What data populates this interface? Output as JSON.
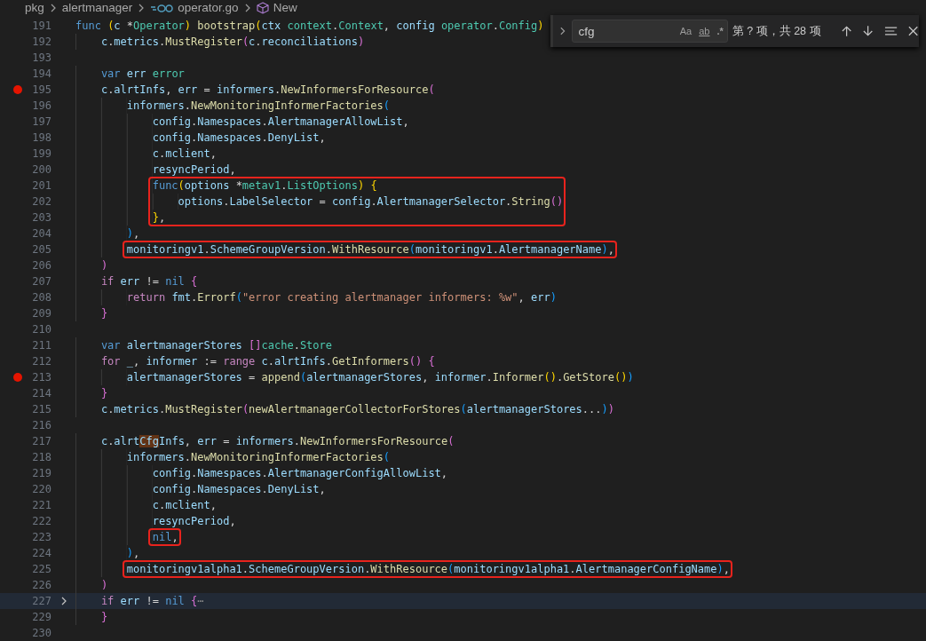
{
  "breadcrumb": [
    {
      "kind": "folder",
      "label": "pkg"
    },
    {
      "kind": "folder",
      "label": "alertmanager"
    },
    {
      "kind": "go-file",
      "label": "operator.go"
    },
    {
      "kind": "symbol",
      "label": "New"
    }
  ],
  "find_widget": {
    "query": "cfg",
    "options": [
      {
        "kind": "case",
        "label": "Aa",
        "on": false
      },
      {
        "kind": "word",
        "label": "ab",
        "on": false
      },
      {
        "kind": "regex",
        "label": ".*",
        "on": false
      }
    ],
    "result": "第 ? 项，共 28 项"
  },
  "lines": [
    {
      "number": "191",
      "breakpoint": false,
      "folded": false,
      "current": false,
      "boxed": false,
      "segments": [
        {
          "kind": "kw",
          "text": "func "
        },
        {
          "kind": "b1",
          "text": "("
        },
        {
          "kind": "var",
          "text": "c"
        },
        {
          "kind": "p",
          "text": " *"
        },
        {
          "kind": "type",
          "text": "Operator"
        },
        {
          "kind": "b1",
          "text": ") "
        },
        {
          "kind": "fn",
          "text": "bootstrap"
        },
        {
          "kind": "b1",
          "text": "("
        },
        {
          "kind": "var",
          "text": "ctx "
        },
        {
          "kind": "type",
          "text": "context"
        },
        {
          "kind": "p",
          "text": "."
        },
        {
          "kind": "type",
          "text": "Context"
        },
        {
          "kind": "p",
          "text": ", "
        },
        {
          "kind": "var",
          "text": "config "
        },
        {
          "kind": "type",
          "text": "operator"
        },
        {
          "kind": "p",
          "text": "."
        },
        {
          "kind": "type",
          "text": "Config"
        },
        {
          "kind": "b1",
          "text": ")"
        }
      ]
    },
    {
      "number": "192",
      "breakpoint": false,
      "folded": false,
      "current": false,
      "boxed": false,
      "segments": [
        {
          "kind": "var",
          "text": "\tc"
        },
        {
          "kind": "p",
          "text": "."
        },
        {
          "kind": "var",
          "text": "metrics"
        },
        {
          "kind": "p",
          "text": "."
        },
        {
          "kind": "fn",
          "text": "MustRegister"
        },
        {
          "kind": "b2",
          "text": "("
        },
        {
          "kind": "var",
          "text": "c"
        },
        {
          "kind": "p",
          "text": "."
        },
        {
          "kind": "var",
          "text": "reconciliations"
        },
        {
          "kind": "b2",
          "text": ")"
        }
      ]
    },
    {
      "number": "193",
      "breakpoint": false,
      "folded": false,
      "current": false,
      "boxed": false
    },
    {
      "number": "194",
      "breakpoint": false,
      "folded": false,
      "current": false,
      "boxed": false,
      "segments": [
        {
          "kind": "kw",
          "text": "\tvar "
        },
        {
          "kind": "var",
          "text": "err "
        },
        {
          "kind": "type",
          "text": "error"
        }
      ]
    },
    {
      "number": "195",
      "breakpoint": true,
      "folded": false,
      "current": false,
      "boxed": false,
      "segments": [
        {
          "kind": "var",
          "text": "\tc"
        },
        {
          "kind": "p",
          "text": "."
        },
        {
          "kind": "var",
          "text": "alrtInfs"
        },
        {
          "kind": "p",
          "text": ", "
        },
        {
          "kind": "var",
          "text": "err"
        },
        {
          "kind": "p",
          "text": " = "
        },
        {
          "kind": "var",
          "text": "informers"
        },
        {
          "kind": "p",
          "text": "."
        },
        {
          "kind": "fn",
          "text": "NewInformersForResource"
        },
        {
          "kind": "b2",
          "text": "("
        }
      ]
    },
    {
      "number": "196",
      "breakpoint": false,
      "folded": false,
      "current": false,
      "boxed": false,
      "segments": [
        {
          "kind": "var",
          "text": "\t\tinformers"
        },
        {
          "kind": "p",
          "text": "."
        },
        {
          "kind": "fn",
          "text": "NewMonitoringInformerFactories"
        },
        {
          "kind": "b3",
          "text": "("
        }
      ]
    },
    {
      "number": "197",
      "breakpoint": false,
      "folded": false,
      "current": false,
      "boxed": false,
      "segments": [
        {
          "kind": "var",
          "text": "\t\t\tconfig"
        },
        {
          "kind": "p",
          "text": "."
        },
        {
          "kind": "var",
          "text": "Namespaces"
        },
        {
          "kind": "p",
          "text": "."
        },
        {
          "kind": "var",
          "text": "AlertmanagerAllowList"
        },
        {
          "kind": "p",
          "text": ","
        }
      ]
    },
    {
      "number": "198",
      "breakpoint": false,
      "folded": false,
      "current": false,
      "boxed": false,
      "segments": [
        {
          "kind": "var",
          "text": "\t\t\tconfig"
        },
        {
          "kind": "p",
          "text": "."
        },
        {
          "kind": "var",
          "text": "Namespaces"
        },
        {
          "kind": "p",
          "text": "."
        },
        {
          "kind": "var",
          "text": "DenyList"
        },
        {
          "kind": "p",
          "text": ","
        }
      ]
    },
    {
      "number": "199",
      "breakpoint": false,
      "folded": false,
      "current": false,
      "boxed": false,
      "segments": [
        {
          "kind": "var",
          "text": "\t\t\tc"
        },
        {
          "kind": "p",
          "text": "."
        },
        {
          "kind": "var",
          "text": "mclient"
        },
        {
          "kind": "p",
          "text": ","
        }
      ]
    },
    {
      "number": "200",
      "breakpoint": false,
      "folded": false,
      "current": false,
      "boxed": false,
      "segments": [
        {
          "kind": "var",
          "text": "\t\t\tresyncPeriod"
        },
        {
          "kind": "p",
          "text": ","
        }
      ]
    },
    {
      "number": "201",
      "breakpoint": false,
      "folded": false,
      "current": false,
      "boxed": true,
      "segments": [
        {
          "kind": "kw",
          "text": "\t\t\tfunc"
        },
        {
          "kind": "b1",
          "text": "("
        },
        {
          "kind": "var",
          "text": "options"
        },
        {
          "kind": "p",
          "text": " *"
        },
        {
          "kind": "type",
          "text": "metav1"
        },
        {
          "kind": "p",
          "text": "."
        },
        {
          "kind": "type",
          "text": "ListOptions"
        },
        {
          "kind": "b1",
          "text": ") {"
        }
      ]
    },
    {
      "number": "202",
      "breakpoint": false,
      "folded": false,
      "current": false,
      "boxed": true,
      "segments": [
        {
          "kind": "var",
          "text": "\t\t\t\toptions"
        },
        {
          "kind": "p",
          "text": "."
        },
        {
          "kind": "var",
          "text": "LabelSelector"
        },
        {
          "kind": "p",
          "text": " = "
        },
        {
          "kind": "var",
          "text": "config"
        },
        {
          "kind": "p",
          "text": "."
        },
        {
          "kind": "var",
          "text": "AlertmanagerSelector"
        },
        {
          "kind": "p",
          "text": "."
        },
        {
          "kind": "fn",
          "text": "String"
        },
        {
          "kind": "b2",
          "text": "()"
        }
      ]
    },
    {
      "number": "203",
      "breakpoint": false,
      "folded": false,
      "current": false,
      "boxed": true,
      "segments": [
        {
          "kind": "b1",
          "text": "\t\t\t}"
        },
        {
          "kind": "p",
          "text": ","
        }
      ]
    },
    {
      "number": "204",
      "breakpoint": false,
      "folded": false,
      "current": false,
      "boxed": false,
      "segments": [
        {
          "kind": "b3",
          "text": "\t\t)"
        },
        {
          "kind": "p",
          "text": ","
        }
      ]
    },
    {
      "number": "205",
      "breakpoint": false,
      "folded": false,
      "current": false,
      "boxed": true,
      "segments": [
        {
          "kind": "var",
          "text": "\t\tmonitoringv1"
        },
        {
          "kind": "p",
          "text": "."
        },
        {
          "kind": "var",
          "text": "SchemeGroupVersion"
        },
        {
          "kind": "p",
          "text": "."
        },
        {
          "kind": "fn",
          "text": "WithResource"
        },
        {
          "kind": "b3",
          "text": "("
        },
        {
          "kind": "var",
          "text": "monitoringv1"
        },
        {
          "kind": "p",
          "text": "."
        },
        {
          "kind": "var",
          "text": "AlertmanagerName"
        },
        {
          "kind": "b3",
          "text": ")"
        },
        {
          "kind": "p",
          "text": ","
        }
      ]
    },
    {
      "number": "206",
      "breakpoint": false,
      "folded": false,
      "current": false,
      "boxed": false,
      "segments": [
        {
          "kind": "b2",
          "text": "\t)"
        }
      ]
    },
    {
      "number": "207",
      "breakpoint": false,
      "folded": false,
      "current": false,
      "boxed": false,
      "segments": [
        {
          "kind": "ctl",
          "text": "\tif "
        },
        {
          "kind": "var",
          "text": "err"
        },
        {
          "kind": "p",
          "text": " != "
        },
        {
          "kind": "kw",
          "text": "nil "
        },
        {
          "kind": "b2",
          "text": "{"
        }
      ]
    },
    {
      "number": "208",
      "breakpoint": false,
      "folded": false,
      "current": false,
      "boxed": false,
      "segments": [
        {
          "kind": "ctl",
          "text": "\t\treturn "
        },
        {
          "kind": "var",
          "text": "fmt"
        },
        {
          "kind": "p",
          "text": "."
        },
        {
          "kind": "fn",
          "text": "Errorf"
        },
        {
          "kind": "b3",
          "text": "("
        },
        {
          "kind": "str",
          "text": "\"error creating alertmanager informers: %w\""
        },
        {
          "kind": "p",
          "text": ", "
        },
        {
          "kind": "var",
          "text": "err"
        },
        {
          "kind": "b3",
          "text": ")"
        }
      ]
    },
    {
      "number": "209",
      "breakpoint": false,
      "folded": false,
      "current": false,
      "boxed": false,
      "segments": [
        {
          "kind": "b2",
          "text": "\t}"
        }
      ]
    },
    {
      "number": "210",
      "breakpoint": false,
      "folded": false,
      "current": false,
      "boxed": false
    },
    {
      "number": "211",
      "breakpoint": false,
      "folded": false,
      "current": false,
      "boxed": false,
      "segments": [
        {
          "kind": "kw",
          "text": "\tvar "
        },
        {
          "kind": "var",
          "text": "alertmanagerStores "
        },
        {
          "kind": "b2",
          "text": "[]"
        },
        {
          "kind": "type",
          "text": "cache"
        },
        {
          "kind": "p",
          "text": "."
        },
        {
          "kind": "type",
          "text": "Store"
        }
      ]
    },
    {
      "number": "212",
      "breakpoint": false,
      "folded": false,
      "current": false,
      "boxed": false,
      "segments": [
        {
          "kind": "ctl",
          "text": "\tfor "
        },
        {
          "kind": "var",
          "text": "_"
        },
        {
          "kind": "p",
          "text": ", "
        },
        {
          "kind": "var",
          "text": "informer"
        },
        {
          "kind": "p",
          "text": " := "
        },
        {
          "kind": "ctl",
          "text": "range "
        },
        {
          "kind": "var",
          "text": "c"
        },
        {
          "kind": "p",
          "text": "."
        },
        {
          "kind": "var",
          "text": "alrtInfs"
        },
        {
          "kind": "p",
          "text": "."
        },
        {
          "kind": "fn",
          "text": "GetInformers"
        },
        {
          "kind": "b2",
          "text": "() {"
        }
      ]
    },
    {
      "number": "213",
      "breakpoint": true,
      "folded": false,
      "current": false,
      "boxed": false,
      "segments": [
        {
          "kind": "var",
          "text": "\t\talertmanagerStores"
        },
        {
          "kind": "p",
          "text": " = "
        },
        {
          "kind": "fn",
          "text": "append"
        },
        {
          "kind": "b3",
          "text": "("
        },
        {
          "kind": "var",
          "text": "alertmanagerStores"
        },
        {
          "kind": "p",
          "text": ", "
        },
        {
          "kind": "var",
          "text": "informer"
        },
        {
          "kind": "p",
          "text": "."
        },
        {
          "kind": "fn",
          "text": "Informer"
        },
        {
          "kind": "b1",
          "text": "()"
        },
        {
          "kind": "p",
          "text": "."
        },
        {
          "kind": "fn",
          "text": "GetStore"
        },
        {
          "kind": "b1",
          "text": "()"
        },
        {
          "kind": "b3",
          "text": ")"
        }
      ]
    },
    {
      "number": "214",
      "breakpoint": false,
      "folded": false,
      "current": false,
      "boxed": false,
      "segments": [
        {
          "kind": "b2",
          "text": "\t}"
        }
      ]
    },
    {
      "number": "215",
      "breakpoint": false,
      "folded": false,
      "current": false,
      "boxed": false,
      "segments": [
        {
          "kind": "var",
          "text": "\tc"
        },
        {
          "kind": "p",
          "text": "."
        },
        {
          "kind": "var",
          "text": "metrics"
        },
        {
          "kind": "p",
          "text": "."
        },
        {
          "kind": "fn",
          "text": "MustRegister"
        },
        {
          "kind": "b2",
          "text": "("
        },
        {
          "kind": "fn",
          "text": "newAlertmanagerCollectorForStores"
        },
        {
          "kind": "b3",
          "text": "("
        },
        {
          "kind": "var",
          "text": "alertmanagerStores"
        },
        {
          "kind": "p",
          "text": "..."
        },
        {
          "kind": "b3",
          "text": ")"
        },
        {
          "kind": "b2",
          "text": ")"
        }
      ]
    },
    {
      "number": "216",
      "breakpoint": false,
      "folded": false,
      "current": false,
      "boxed": false
    },
    {
      "number": "217",
      "breakpoint": false,
      "folded": false,
      "current": false,
      "boxed": false,
      "segments": [
        {
          "kind": "var",
          "text": "\tc"
        },
        {
          "kind": "p",
          "text": "."
        },
        {
          "kind": "var",
          "text": "alrt"
        },
        {
          "kind": "match",
          "text": "Cfg"
        },
        {
          "kind": "var",
          "text": "Infs"
        },
        {
          "kind": "p",
          "text": ", "
        },
        {
          "kind": "var",
          "text": "err"
        },
        {
          "kind": "p",
          "text": " = "
        },
        {
          "kind": "var",
          "text": "informers"
        },
        {
          "kind": "p",
          "text": "."
        },
        {
          "kind": "fn",
          "text": "NewInformersForResource"
        },
        {
          "kind": "b2",
          "text": "("
        }
      ]
    },
    {
      "number": "218",
      "breakpoint": false,
      "folded": false,
      "current": false,
      "boxed": false,
      "segments": [
        {
          "kind": "var",
          "text": "\t\tinformers"
        },
        {
          "kind": "p",
          "text": "."
        },
        {
          "kind": "fn",
          "text": "NewMonitoringInformerFactories"
        },
        {
          "kind": "b3",
          "text": "("
        }
      ]
    },
    {
      "number": "219",
      "breakpoint": false,
      "folded": false,
      "current": false,
      "boxed": false,
      "segments": [
        {
          "kind": "var",
          "text": "\t\t\tconfig"
        },
        {
          "kind": "p",
          "text": "."
        },
        {
          "kind": "var",
          "text": "Namespaces"
        },
        {
          "kind": "p",
          "text": "."
        },
        {
          "kind": "var",
          "text": "AlertmanagerConfigAllowList"
        },
        {
          "kind": "p",
          "text": ","
        }
      ]
    },
    {
      "number": "220",
      "breakpoint": false,
      "folded": false,
      "current": false,
      "boxed": false,
      "segments": [
        {
          "kind": "var",
          "text": "\t\t\tconfig"
        },
        {
          "kind": "p",
          "text": "."
        },
        {
          "kind": "var",
          "text": "Namespaces"
        },
        {
          "kind": "p",
          "text": "."
        },
        {
          "kind": "var",
          "text": "DenyList"
        },
        {
          "kind": "p",
          "text": ","
        }
      ]
    },
    {
      "number": "221",
      "breakpoint": false,
      "folded": false,
      "current": false,
      "boxed": false,
      "segments": [
        {
          "kind": "var",
          "text": "\t\t\tc"
        },
        {
          "kind": "p",
          "text": "."
        },
        {
          "kind": "var",
          "text": "mclient"
        },
        {
          "kind": "p",
          "text": ","
        }
      ]
    },
    {
      "number": "222",
      "breakpoint": false,
      "folded": false,
      "current": false,
      "boxed": false,
      "segments": [
        {
          "kind": "var",
          "text": "\t\t\tresyncPeriod"
        },
        {
          "kind": "p",
          "text": ","
        }
      ]
    },
    {
      "number": "223",
      "breakpoint": false,
      "folded": false,
      "current": false,
      "boxed": true,
      "segments": [
        {
          "kind": "kw",
          "text": "\t\t\tnil"
        },
        {
          "kind": "p",
          "text": ","
        }
      ]
    },
    {
      "number": "224",
      "breakpoint": false,
      "folded": false,
      "current": false,
      "boxed": false,
      "segments": [
        {
          "kind": "b3",
          "text": "\t\t)"
        },
        {
          "kind": "p",
          "text": ","
        }
      ]
    },
    {
      "number": "225",
      "breakpoint": false,
      "folded": false,
      "current": false,
      "boxed": true,
      "segments": [
        {
          "kind": "var",
          "text": "\t\tmonitoringv1alpha1"
        },
        {
          "kind": "p",
          "text": "."
        },
        {
          "kind": "var",
          "text": "SchemeGroupVersion"
        },
        {
          "kind": "p",
          "text": "."
        },
        {
          "kind": "fn",
          "text": "WithResource"
        },
        {
          "kind": "b3",
          "text": "("
        },
        {
          "kind": "var",
          "text": "monitoringv1alpha1"
        },
        {
          "kind": "p",
          "text": "."
        },
        {
          "kind": "var",
          "text": "AlertmanagerConfigName"
        },
        {
          "kind": "b3",
          "text": ")"
        },
        {
          "kind": "p",
          "text": ","
        }
      ]
    },
    {
      "number": "226",
      "breakpoint": false,
      "folded": false,
      "current": false,
      "boxed": false,
      "segments": [
        {
          "kind": "b2",
          "text": "\t)"
        }
      ]
    },
    {
      "number": "227",
      "breakpoint": false,
      "folded": true,
      "current": true,
      "boxed": false,
      "segments": [
        {
          "kind": "ctl",
          "text": "\tif "
        },
        {
          "kind": "var",
          "text": "err"
        },
        {
          "kind": "p",
          "text": " != "
        },
        {
          "kind": "kw",
          "text": "nil "
        },
        {
          "kind": "b2",
          "text": "{"
        },
        {
          "kind": "fold",
          "text": "⋯"
        }
      ]
    },
    {
      "number": "229",
      "breakpoint": false,
      "folded": false,
      "current": false,
      "boxed": false,
      "segments": [
        {
          "kind": "b2",
          "text": "\t}"
        }
      ]
    },
    {
      "number": "230",
      "breakpoint": false,
      "folded": false,
      "current": false,
      "boxed": false
    }
  ]
}
